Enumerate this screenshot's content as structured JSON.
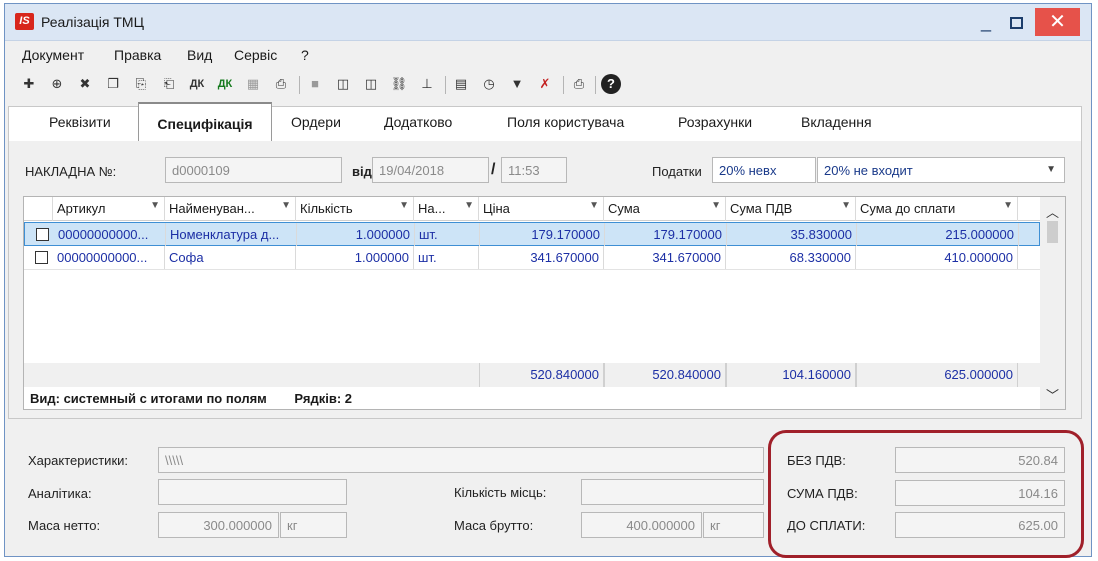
{
  "window": {
    "logo": "IS",
    "title": "Реалізація ТМЦ",
    "minimize": "_",
    "close": "✕"
  },
  "menu": [
    "Документ",
    "Правка",
    "Вид",
    "Сервіс",
    "?"
  ],
  "toolbar_icons": [
    "add-icon",
    "add-copy-icon",
    "delete-icon",
    "copy-icon",
    "insert-icon",
    "insert2-icon",
    "dk-icon",
    "dk2-icon",
    "calc-icon",
    "print-preview-icon",
    "gray-square-icon",
    "split-left-icon",
    "split-right-icon",
    "link-icon",
    "tree-icon",
    "table-icon",
    "clock-icon",
    "filter-icon",
    "filter-clear-icon",
    "printer-icon",
    "help-icon"
  ],
  "tabs": [
    "Реквізити",
    "Специфікація",
    "Ордери",
    "Додатково",
    "Поля користувача",
    "Розрахунки",
    "Вкладення"
  ],
  "header": {
    "invoice_label": "НАКЛАДНА №:",
    "invoice_number": "d0000109",
    "date_label": "від",
    "date": "19/04/2018",
    "slash": "/",
    "time": "11:53",
    "taxes_label": "Податки",
    "tax_code": "20% невх",
    "tax_name": "20% не входит"
  },
  "table": {
    "columns": [
      "Артикул",
      "Найменуван...",
      "Кількість",
      "На...",
      "Ціна",
      "Сума",
      "Сума ПДВ",
      "Сума до сплати"
    ],
    "rows": [
      {
        "article": "00000000000...",
        "name": "Номенклатура д...",
        "qty": "1.000000",
        "unit": "шт.",
        "price": "179.170000",
        "sum": "179.170000",
        "vat": "35.830000",
        "total": "215.000000"
      },
      {
        "article": "00000000000...",
        "name": "Софа",
        "qty": "1.000000",
        "unit": "шт.",
        "price": "341.670000",
        "sum": "341.670000",
        "vat": "68.330000",
        "total": "410.000000"
      }
    ],
    "totals": {
      "price": "520.840000",
      "sum": "520.840000",
      "vat": "104.160000",
      "total": "625.000000"
    },
    "view_label": "Вид: системный с итогами по полям",
    "rows_count_label": "Рядків: 2"
  },
  "bottom": {
    "characteristics_label": "Характеристики:",
    "characteristics_value": "\\\\\\\\\\",
    "analytics_label": "Аналітика:",
    "analytics_value": "",
    "places_label": "Кількість місць:",
    "places_value": "",
    "net_mass_label": "Маса нетто:",
    "net_mass_value": "300.000000",
    "net_mass_unit": "кг",
    "gross_mass_label": "Маса брутто:",
    "gross_mass_value": "400.000000",
    "gross_mass_unit": "кг",
    "without_vat_label": "БЕЗ ПДВ:",
    "without_vat_value": "520.84",
    "vat_sum_label": "СУМА ПДВ:",
    "vat_sum_value": "104.16",
    "to_pay_label": "ДО СПЛАТИ:",
    "to_pay_value": "625.00"
  }
}
